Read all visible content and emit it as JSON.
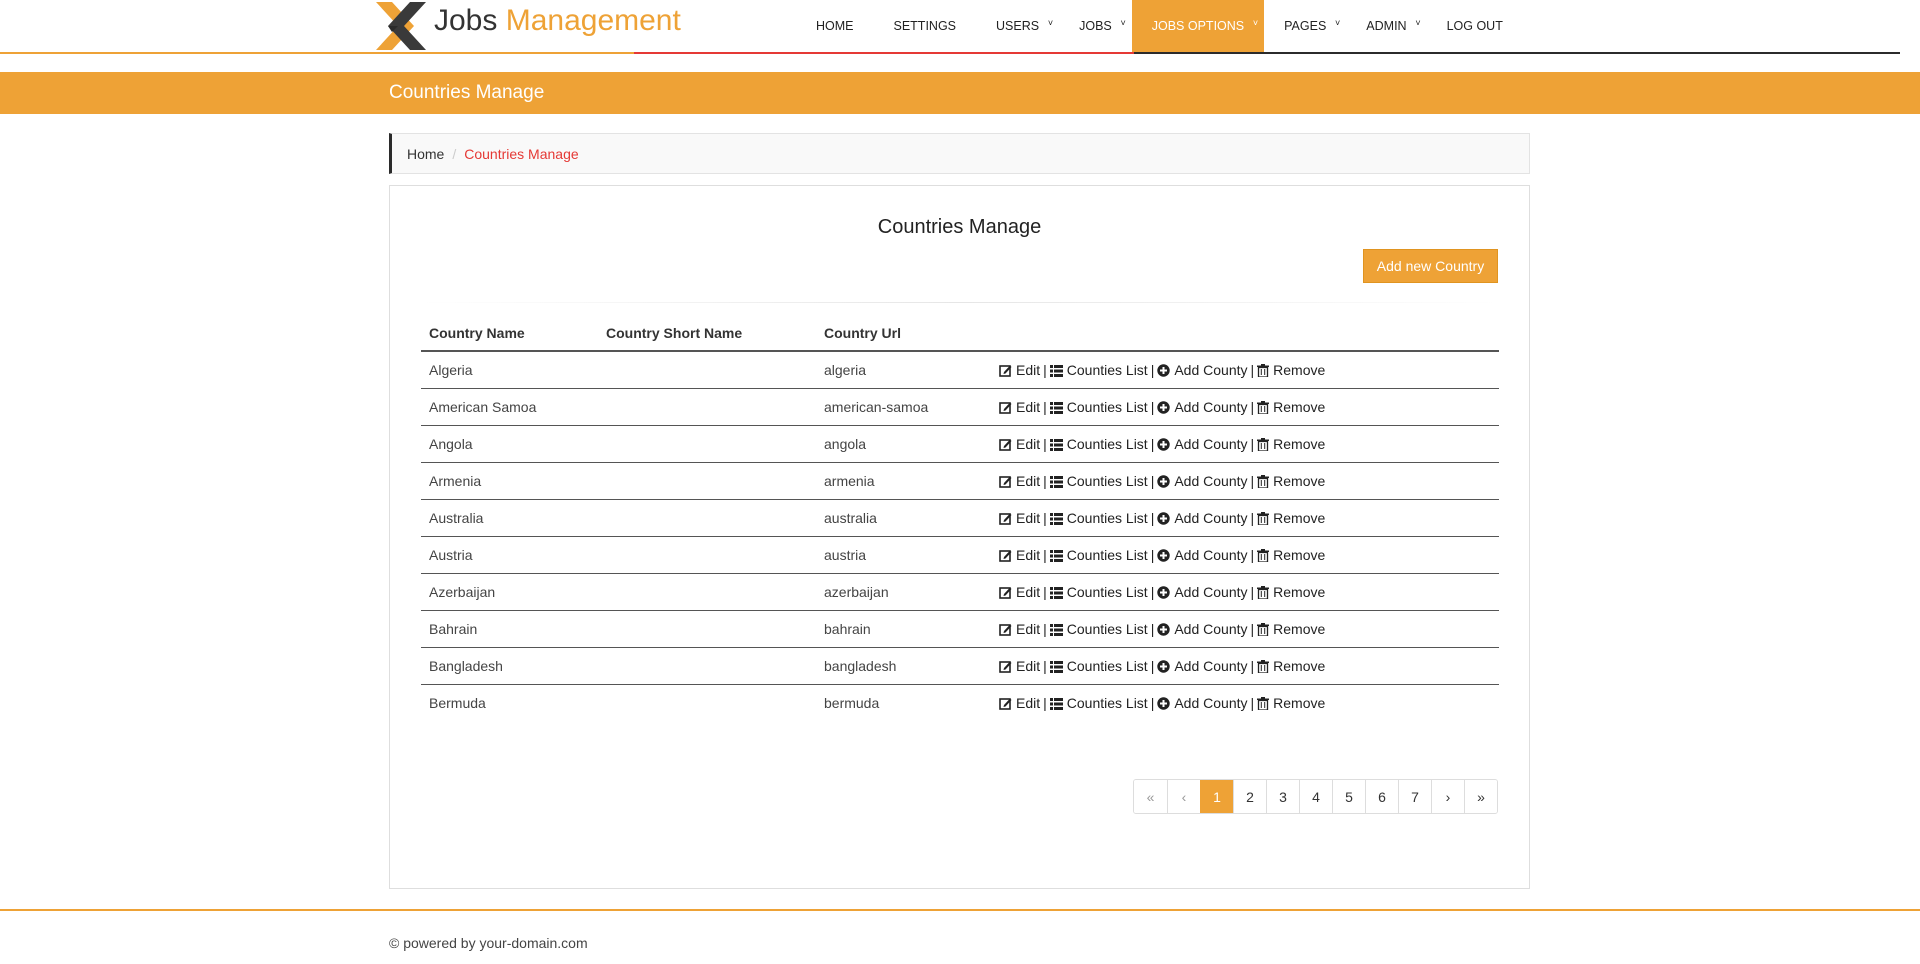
{
  "header": {
    "logo_word1": "Jobs",
    "logo_word2": "Management",
    "nav": [
      {
        "label": "HOME",
        "dropdown": false
      },
      {
        "label": "SETTINGS",
        "dropdown": false
      },
      {
        "label": "USERS",
        "dropdown": true
      },
      {
        "label": "JOBS",
        "dropdown": true
      },
      {
        "label": "JOBS OPTIONS",
        "dropdown": true,
        "active": true
      },
      {
        "label": "PAGES",
        "dropdown": true
      },
      {
        "label": "ADMIN",
        "dropdown": true
      },
      {
        "label": "LOG OUT",
        "dropdown": false
      }
    ]
  },
  "page_title": "Countries Manage",
  "breadcrumb": {
    "home": "Home",
    "sep": "/",
    "current": "Countries Manage"
  },
  "panel": {
    "title": "Countries Manage",
    "add_button": "Add new Country"
  },
  "table": {
    "headers": [
      "Country Name",
      "Country Short Name",
      "Country Url",
      ""
    ],
    "action_labels": {
      "edit": "Edit",
      "list": "Counties List",
      "add": "Add County",
      "remove": "Remove",
      "sep": "|"
    },
    "rows": [
      {
        "name": "Algeria",
        "short": "",
        "url": "algeria"
      },
      {
        "name": "American Samoa",
        "short": "",
        "url": "american-samoa"
      },
      {
        "name": "Angola",
        "short": "",
        "url": "angola"
      },
      {
        "name": "Armenia",
        "short": "",
        "url": "armenia"
      },
      {
        "name": "Australia",
        "short": "",
        "url": "australia"
      },
      {
        "name": "Austria",
        "short": "",
        "url": "austria"
      },
      {
        "name": "Azerbaijan",
        "short": "",
        "url": "azerbaijan"
      },
      {
        "name": "Bahrain",
        "short": "",
        "url": "bahrain"
      },
      {
        "name": "Bangladesh",
        "short": "",
        "url": "bangladesh"
      },
      {
        "name": "Bermuda",
        "short": "",
        "url": "bermuda"
      }
    ]
  },
  "pagination": {
    "first": "«",
    "prev": "‹",
    "pages": [
      "1",
      "2",
      "3",
      "4",
      "5",
      "6",
      "7"
    ],
    "current": "1",
    "next": "›",
    "last": "»"
  },
  "footer": {
    "text": "© powered by your-domain.com"
  },
  "colors": {
    "accent": "#eea236",
    "breadcrumb_active": "#e53935"
  }
}
